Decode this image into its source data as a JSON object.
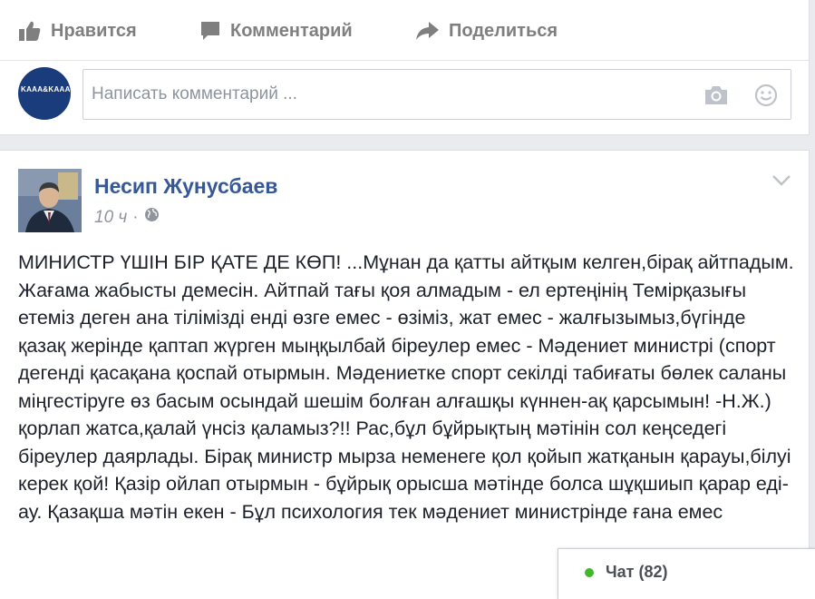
{
  "top_post": {
    "actions": {
      "like": "Нравится",
      "comment": "Комментарий",
      "share": "Поделиться"
    },
    "commenter_avatar_text": "KAAA&KAAA",
    "comment_placeholder": "Написать комментарий ..."
  },
  "post": {
    "author": "Несип Жунусбаев",
    "time": "10 ч",
    "privacy_icon": "globe-icon",
    "text": "МИНИСТР ҮШІН БІР ҚАТЕ ДЕ КӨП! ...Мұнан да қатты айтқым келген,бірақ айтпадым. Жағама жабысты демесін. Айтпай тағы қоя алмадым - ел ертеңінің Темірқазығы етеміз деген ана тілімізді енді өзге емес - өзіміз, жат емес - жалғызымыз,бүгінде қазақ жерінде қаптап жүрген мыңқылбай біреулер емес - Мәдениет министрі (спорт дегенді қасақана қоспай отырмын. Мәдениетке спорт секілді табиғаты бөлек саланы міңгестіруге өз басым осындай шешім болған алғашқы күннен-ақ қарсымын! -Н.Ж.) қорлап жатса,қалай үнсіз қаламыз?!! Рас,бұл бұйрықтың мәтінін сол кеңседегі біреулер даярлады. Бірақ министр мырза неменеге қол қойып жатқанын қарауы,білуі керек қой! Қазір ойлап отырмын - бұйрық орысша мәтінде болса шұқшиып қарар еді-ау. Қазақша мәтін екен - Бұл психология тек мәдениет министрінде ғана емес"
  },
  "chat": {
    "label": "Чат (82)",
    "status_color": "#42b72a"
  },
  "colors": {
    "link": "#365899",
    "background": "#e9ebee"
  }
}
